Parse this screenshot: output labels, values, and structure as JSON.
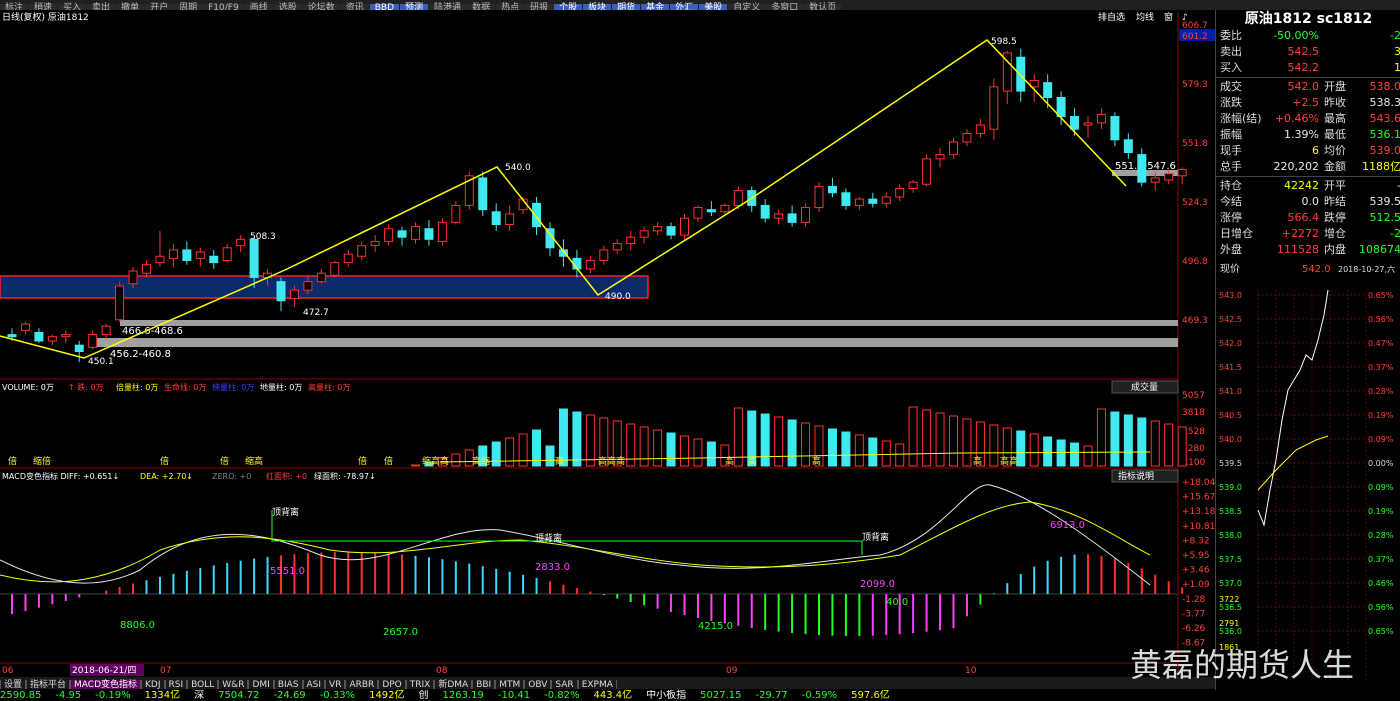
{
  "toolbar": {
    "items": [
      "标注",
      "稍速",
      "买入",
      "卖出",
      "撤单",
      "开户",
      "周期",
      "F10/F9",
      "画线",
      "选股",
      "论坛数",
      "资讯",
      "BBD",
      "预测",
      "陆港通",
      "数据",
      "热点",
      "研报",
      "个股",
      "板块",
      "期货",
      "基金",
      "外汇",
      "美股",
      "自定义",
      "多窗口",
      "数认页"
    ]
  },
  "header": {
    "left": "日线(复权) 原油1812",
    "right_items": [
      "排自选",
      "均线",
      "窗",
      "♪"
    ]
  },
  "price_axis": [
    "606.7",
    "601.2",
    "579.3",
    "551.8",
    "524.3",
    "496.8",
    "469.3"
  ],
  "price_axis_highlight": "601.2",
  "annotations": {
    "high": "598.5",
    "p540": "540.0",
    "p508": "508.3",
    "p490": "490.0",
    "p472": "472.7",
    "p450": "450.1",
    "zone1": "466.6-468.6",
    "zone2": "456.2-460.8",
    "zone3": "551.0-547.6"
  },
  "volume": {
    "header": [
      {
        "t": "VOLUME: 0万",
        "c": "#ffffff"
      },
      {
        "t": "↑ 跌: 0万",
        "c": "#ff4040"
      },
      {
        "t": "倍量柱: 0万",
        "c": "#ffff00"
      },
      {
        "t": "生命线: 0万",
        "c": "#ff4040"
      },
      {
        "t": "梯量柱: 0万",
        "c": "#4040ff"
      },
      {
        "t": "地量柱: 0万",
        "c": "#ffffff"
      },
      {
        "t": "高量柱: 0万",
        "c": "#ff4040"
      }
    ],
    "button": "成交量",
    "axis": [
      "5057",
      "3818",
      "2528",
      "1280",
      "X100"
    ],
    "labels": [
      "倍",
      "缩倍",
      "倍",
      "倍",
      "缩高",
      "倍",
      "倍",
      "缩高高",
      "高缩",
      "高",
      "高高高",
      "高",
      "高",
      "高",
      "高",
      "高高"
    ]
  },
  "macd": {
    "header": [
      {
        "t": "MACD变色指标 DIFF: +0.651↓",
        "c": "#ffffff"
      },
      {
        "t": "DEA: +2.70↓",
        "c": "#ffff00"
      },
      {
        "t": "ZERO: +0",
        "c": "#808080"
      },
      {
        "t": "红面积: +0",
        "c": "#ff4040"
      },
      {
        "t": "绿面积: -78.97↓",
        "c": "#ffffff"
      }
    ],
    "button": "指标说明",
    "axis": [
      "+18.04",
      "+15.67",
      "+13.18",
      "+10.81",
      "+8.32",
      "+5.95",
      "+3.46",
      "+1.09",
      "-1.28",
      "-3.77",
      "-6.26",
      "-8.67"
    ],
    "divergence_labels": [
      "顶背离",
      "顶背离",
      "顶背离"
    ],
    "area_labels": {
      "a1": "5551.0",
      "a2": "2833.0",
      "a3": "2099.0",
      "a4": "6913.0",
      "b1": "8806.0",
      "b2": "2657.0",
      "b3": "4215.0",
      "b4": "40.0"
    }
  },
  "xaxis": {
    "labels": [
      "06",
      "07",
      "08",
      "09",
      "10"
    ],
    "highlight": "2018-06-21/四"
  },
  "tabs": [
    "设置",
    "指标平台",
    "MACD变色指标",
    "KDJ",
    "RSI",
    "BOLL",
    "W&R",
    "DMI",
    "BIAS",
    "ASI",
    "VR",
    "ARBR",
    "DPO",
    "TRIX",
    "新DMA",
    "BBI",
    "MTM",
    "OBV",
    "SAR",
    "EXPMA"
  ],
  "tabs_active": "MACD变色指标",
  "status": [
    {
      "t": "2590.85",
      "c": "#20ff20"
    },
    {
      "t": "-4.95",
      "c": "#20ff20"
    },
    {
      "t": "-0.19%",
      "c": "#20ff20"
    },
    {
      "t": "1334亿",
      "c": "#ffff00"
    },
    {
      "t": "深",
      "c": "#ffffff"
    },
    {
      "t": "7504.72",
      "c": "#20ff20"
    },
    {
      "t": "-24.69",
      "c": "#20ff20"
    },
    {
      "t": "-0.33%",
      "c": "#20ff20"
    },
    {
      "t": "1492亿",
      "c": "#ffff00"
    },
    {
      "t": "创",
      "c": "#ffffff"
    },
    {
      "t": "1263.19",
      "c": "#20ff20"
    },
    {
      "t": "-10.41",
      "c": "#20ff20"
    },
    {
      "t": "-0.82%",
      "c": "#20ff20"
    },
    {
      "t": "443.4亿",
      "c": "#ffff00"
    },
    {
      "t": "中小板指",
      "c": "#ffffff"
    },
    {
      "t": "5027.15",
      "c": "#20ff20"
    },
    {
      "t": "-29.77",
      "c": "#20ff20"
    },
    {
      "t": "-0.59%",
      "c": "#20ff20"
    },
    {
      "t": "597.6亿",
      "c": "#ffff00"
    }
  ],
  "quote": {
    "title": "原油1812 sc1812",
    "rows1": [
      {
        "l1": "委比",
        "v1": "-50.00%",
        "c1": "green",
        "l2": "",
        "v2": "-2",
        "c2": "green"
      },
      {
        "l1": "卖出",
        "v1": "542.5",
        "c1": "red",
        "l2": "",
        "v2": "3",
        "c2": "yellow"
      },
      {
        "l1": "买入",
        "v1": "542.2",
        "c1": "red",
        "l2": "",
        "v2": "1",
        "c2": "yellow"
      }
    ],
    "rows2": [
      {
        "l1": "成交",
        "v1": "542.0",
        "c1": "red",
        "l2": "开盘",
        "v2": "538.0",
        "c2": "red"
      },
      {
        "l1": "涨跌",
        "v1": "+2.5",
        "c1": "red",
        "l2": "昨收",
        "v2": "538.3",
        "c2": "white"
      },
      {
        "l1": "涨幅(结)",
        "v1": "+0.46%",
        "c1": "red",
        "l2": "最高",
        "v2": "543.6",
        "c2": "red"
      },
      {
        "l1": "振幅",
        "v1": "1.39%",
        "c1": "white",
        "l2": "最低",
        "v2": "536.1",
        "c2": "green"
      },
      {
        "l1": "现手",
        "v1": "6",
        "c1": "yellow",
        "l2": "均价",
        "v2": "539.0",
        "c2": "red"
      },
      {
        "l1": "总手",
        "v1": "220,202",
        "c1": "white",
        "l2": "金额",
        "v2": "1188亿",
        "c2": "yellow"
      }
    ],
    "rows3": [
      {
        "l1": "持仓",
        "v1": "42242",
        "c1": "yellow",
        "l2": "开平",
        "v2": "-",
        "c2": "white"
      },
      {
        "l1": "今结",
        "v1": "0.0",
        "c1": "white",
        "l2": "昨结",
        "v2": "539.5",
        "c2": "white"
      },
      {
        "l1": "涨停",
        "v1": "566.4",
        "c1": "red",
        "l2": "跌停",
        "v2": "512.5",
        "c2": "green"
      },
      {
        "l1": "日增仓",
        "v1": "+2272",
        "c1": "red",
        "l2": "增仓",
        "v2": "-2",
        "c2": "green"
      },
      {
        "l1": "外盘",
        "v1": "111528",
        "c1": "red",
        "l2": "内盘",
        "v2": "108674",
        "c2": "green"
      }
    ],
    "intraday_label": "现价",
    "intraday_price": "542.0",
    "intraday_date": "2018-10-27,六",
    "intraday_left": [
      "543.0",
      "542.5",
      "542.0",
      "541.5",
      "541.0",
      "540.5",
      "540.0",
      "539.5",
      "539.0",
      "538.5",
      "538.0",
      "537.5",
      "537.0",
      "536.5",
      "536.0"
    ],
    "intraday_right": [
      "0.65%",
      "0.56%",
      "0.47%",
      "0.37%",
      "0.28%",
      "0.19%",
      "0.09%",
      "0.00%",
      "0.09%",
      "0.19%",
      "0.28%",
      "0.37%",
      "0.46%",
      "0.56%",
      "0.65%"
    ],
    "intraday_vol": [
      "3722",
      "2791",
      "1861"
    ]
  },
  "watermark": "黄磊的期货人生",
  "colors": {
    "up": "#ff3030",
    "down": "#40e8f0",
    "zigzag": "#ffff00",
    "zone": "#0a2a6a"
  },
  "chart_data": {
    "type": "candlestick",
    "ohlc": [
      [
        463,
        466,
        460,
        462
      ],
      [
        465,
        469,
        463,
        468
      ],
      [
        464,
        466,
        459,
        460
      ],
      [
        460,
        463,
        458,
        462
      ],
      [
        462,
        465,
        459,
        463
      ],
      [
        458,
        460,
        450,
        455
      ],
      [
        457,
        465,
        456,
        463
      ],
      [
        463,
        468,
        461,
        467
      ],
      [
        470,
        488,
        469,
        486
      ],
      [
        487,
        495,
        485,
        493
      ],
      [
        492,
        498,
        490,
        496
      ],
      [
        497,
        512,
        495,
        500
      ],
      [
        499,
        506,
        495,
        503
      ],
      [
        503,
        507,
        496,
        498
      ],
      [
        499,
        504,
        495,
        502
      ],
      [
        500,
        503,
        494,
        497
      ],
      [
        498,
        506,
        497,
        504
      ],
      [
        505,
        510,
        502,
        508
      ],
      [
        508,
        509,
        485,
        490
      ],
      [
        490,
        494,
        486,
        492
      ],
      [
        488,
        490,
        474,
        479
      ],
      [
        480,
        486,
        476,
        484
      ],
      [
        484,
        491,
        482,
        488
      ],
      [
        488,
        494,
        487,
        492
      ],
      [
        491,
        498,
        490,
        497
      ],
      [
        497,
        503,
        495,
        501
      ],
      [
        500,
        507,
        498,
        505
      ],
      [
        505,
        510,
        502,
        507
      ],
      [
        507,
        515,
        505,
        513
      ],
      [
        512,
        514,
        505,
        509
      ],
      [
        508,
        516,
        506,
        514
      ],
      [
        513,
        517,
        505,
        508
      ],
      [
        507,
        518,
        505,
        516
      ],
      [
        516,
        526,
        515,
        524
      ],
      [
        524,
        540,
        522,
        538
      ],
      [
        537,
        540,
        519,
        522
      ],
      [
        521,
        525,
        512,
        515
      ],
      [
        515,
        524,
        512,
        520
      ],
      [
        522,
        528,
        520,
        527
      ],
      [
        525,
        528,
        510,
        514
      ],
      [
        513,
        516,
        500,
        504
      ],
      [
        503,
        508,
        495,
        500
      ],
      [
        499,
        503,
        490,
        494
      ],
      [
        494,
        500,
        492,
        498
      ],
      [
        498,
        505,
        496,
        503
      ],
      [
        503,
        508,
        501,
        506
      ],
      [
        506,
        512,
        503,
        509
      ],
      [
        509,
        514,
        506,
        512
      ],
      [
        512,
        516,
        510,
        514
      ],
      [
        514,
        516,
        508,
        510
      ],
      [
        510,
        520,
        508,
        518
      ],
      [
        518,
        524,
        516,
        523
      ],
      [
        522,
        526,
        519,
        521
      ],
      [
        521,
        525,
        519,
        524
      ],
      [
        524,
        533,
        522,
        531
      ],
      [
        531,
        533,
        521,
        524
      ],
      [
        524,
        527,
        516,
        518
      ],
      [
        518,
        522,
        515,
        520
      ],
      [
        520,
        524,
        514,
        516
      ],
      [
        516,
        525,
        514,
        523
      ],
      [
        523,
        535,
        521,
        533
      ],
      [
        533,
        537,
        528,
        530
      ],
      [
        530,
        532,
        522,
        524
      ],
      [
        524,
        528,
        522,
        527
      ],
      [
        527,
        530,
        523,
        525
      ],
      [
        525,
        530,
        523,
        528
      ],
      [
        528,
        534,
        526,
        532
      ],
      [
        532,
        536,
        530,
        535
      ],
      [
        534,
        548,
        533,
        546
      ],
      [
        546,
        551,
        542,
        548
      ],
      [
        548,
        556,
        546,
        554
      ],
      [
        554,
        560,
        552,
        558
      ],
      [
        558,
        565,
        556,
        562
      ],
      [
        560,
        584,
        555,
        580
      ],
      [
        578,
        597,
        572,
        596
      ],
      [
        594,
        598,
        573,
        578
      ],
      [
        580,
        586,
        573,
        583
      ],
      [
        582,
        586,
        570,
        575
      ],
      [
        575,
        578,
        562,
        566
      ],
      [
        566,
        570,
        557,
        560
      ],
      [
        562,
        566,
        556,
        563
      ],
      [
        563,
        570,
        560,
        567
      ],
      [
        566,
        568,
        552,
        555
      ],
      [
        555,
        558,
        546,
        549
      ],
      [
        548,
        551,
        533,
        535
      ],
      [
        535,
        540,
        531,
        537
      ],
      [
        536,
        541,
        534,
        539
      ],
      [
        538,
        542,
        534,
        541
      ]
    ]
  }
}
